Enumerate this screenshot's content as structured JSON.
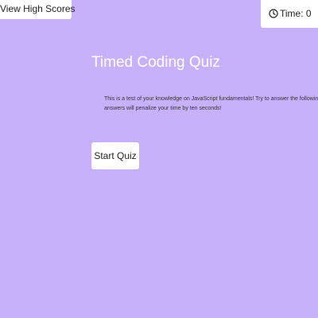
{
  "header": {
    "high_scores_label": "View High Scores",
    "timer": {
      "icon": "clock-icon",
      "text": "Time: 0"
    }
  },
  "main": {
    "title": "Timed Coding Quiz",
    "description_lines": [
      "This is a test of your knowledge on JavaScript fundamentals! Try to answer the following code-related questions within the time limit. Keep in mind that incorrect",
      "answers will penalize your time by ten seconds!"
    ],
    "start_button_label": "Start Quiz"
  },
  "colors": {
    "background": "#c7b1fb",
    "surface": "#ffffff",
    "title_text": "#ffffff",
    "body_text": "#333333"
  }
}
